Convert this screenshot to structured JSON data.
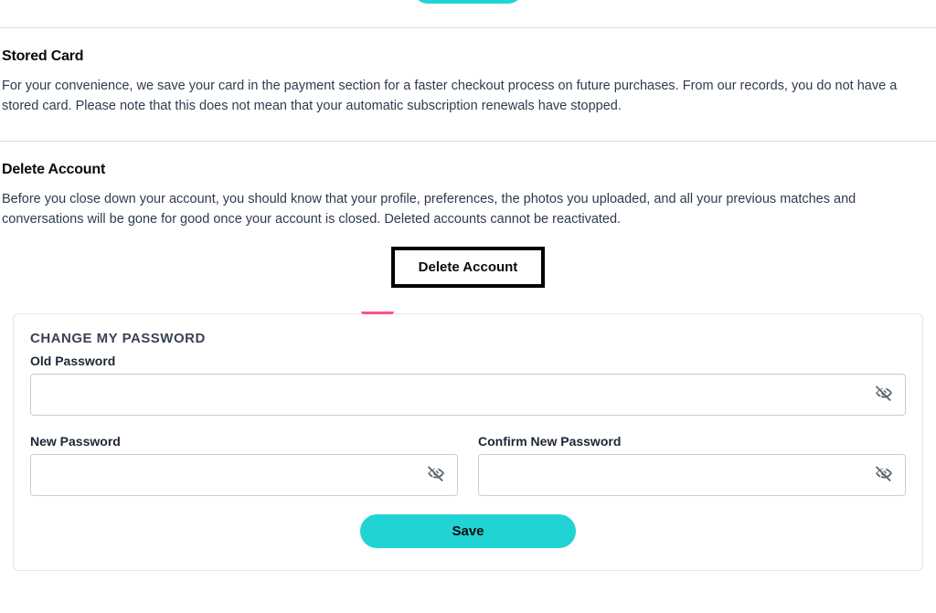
{
  "stored_card": {
    "heading": "Stored Card",
    "text": "For your convenience, we save your card in the payment section for a faster checkout process on future purchases. From our records, you do not have a stored card. Please note that this does not mean that your automatic subscription renewals have stopped."
  },
  "delete_account": {
    "heading": "Delete Account",
    "text": "Before you close down your account, you should know that your profile, preferences, the photos you uploaded, and all your previous matches and conversations will be gone for good once your account is closed. Deleted accounts cannot be reactivated.",
    "button_label": "Delete Account"
  },
  "change_password": {
    "heading": "CHANGE MY PASSWORD",
    "old_label": "Old Password",
    "new_label": "New Password",
    "confirm_label": "Confirm New Password",
    "old_value": "",
    "new_value": "",
    "confirm_value": "",
    "save_label": "Save"
  }
}
